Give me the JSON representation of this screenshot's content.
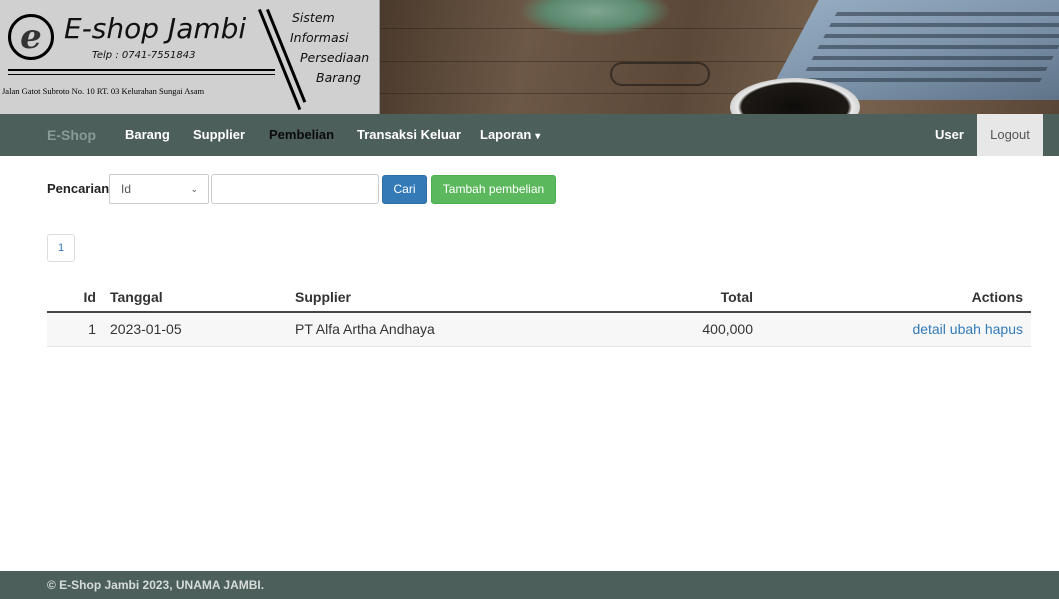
{
  "banner": {
    "shop_name": "E-shop Jambi",
    "telp": "Telp : 0741-7551843",
    "address": "Jalan Gatot Subroto No. 10 RT. 03 Kelurahan Sungai Asam",
    "system_line1": "Sistem",
    "system_line2": "Informasi",
    "system_line3": "Persediaan",
    "system_line4": "Barang"
  },
  "navbar": {
    "brand": "E-Shop",
    "items": [
      {
        "label": "Barang"
      },
      {
        "label": "Supplier"
      },
      {
        "label": "Pembelian",
        "active": true
      },
      {
        "label": "Transaksi Keluar"
      },
      {
        "label": "Laporan"
      }
    ],
    "user": "User",
    "logout": "Logout"
  },
  "search": {
    "label": "Pencarian",
    "field_selected": "Id",
    "input_value": "",
    "button_search": "Cari",
    "button_add": "Tambah pembelian"
  },
  "pagination": {
    "current_page": "1"
  },
  "table": {
    "headers": {
      "id": "Id",
      "tanggal": "Tanggal",
      "supplier": "Supplier",
      "total": "Total",
      "actions": "Actions"
    },
    "rows": [
      {
        "id": "1",
        "tanggal": "2023-01-05",
        "supplier": "PT Alfa Artha Andhaya",
        "total": "400,000",
        "actions": {
          "detail": "detail",
          "ubah": "ubah",
          "hapus": "hapus"
        }
      }
    ]
  },
  "footer": {
    "text": "© E-Shop Jambi 2023, UNAMA JAMBI."
  },
  "colors": {
    "navbar": "#4c5f5a",
    "primary": "#337ab7",
    "success": "#5cb85c"
  }
}
